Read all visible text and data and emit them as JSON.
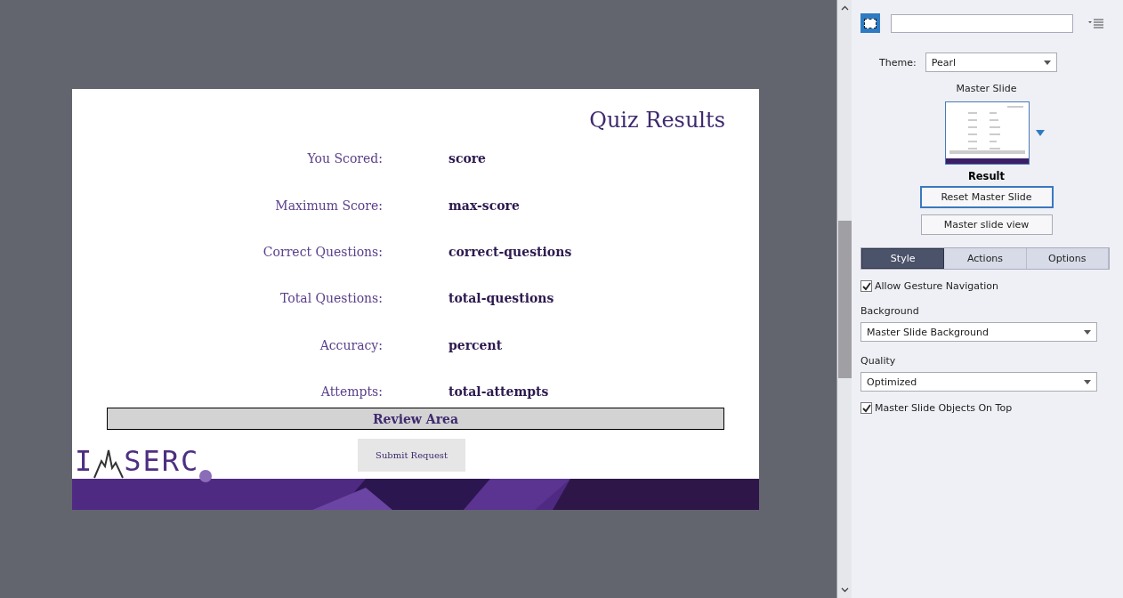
{
  "slide": {
    "title": "Quiz Results",
    "rows": [
      {
        "label": "You Scored:",
        "value": "score"
      },
      {
        "label": "Maximum Score:",
        "value": "max-score"
      },
      {
        "label": "Correct Questions:",
        "value": "correct-questions"
      },
      {
        "label": "Total Questions:",
        "value": "total-questions"
      },
      {
        "label": "Accuracy:",
        "value": "percent"
      },
      {
        "label": "Attempts:",
        "value": "total-attempts"
      }
    ],
    "review_area": "Review Area",
    "submit_button": "Submit Request",
    "logo": {
      "before": "I",
      "after": "SERC"
    }
  },
  "panel": {
    "theme": {
      "label": "Theme:",
      "value": "Pearl"
    },
    "master_slide_label": "Master Slide",
    "master_slide_name": "Result",
    "buttons": [
      {
        "label": "Reset Master Slide",
        "focused": true
      },
      {
        "label": "Master slide view",
        "focused": false
      }
    ],
    "tabs": [
      {
        "label": "Style",
        "selected": true
      },
      {
        "label": "Actions",
        "selected": false
      },
      {
        "label": "Options",
        "selected": false
      }
    ],
    "settings": [
      {
        "kind": "checkbox",
        "label": "Allow Gesture Navigation",
        "checked": true
      },
      {
        "kind": "dropdown",
        "label": "Background",
        "value": "Master Slide Background"
      },
      {
        "kind": "dropdown",
        "label": "Quality",
        "value": "Optimized"
      },
      {
        "kind": "checkbox",
        "label": "Master Slide Objects On Top",
        "checked": true
      }
    ]
  }
}
